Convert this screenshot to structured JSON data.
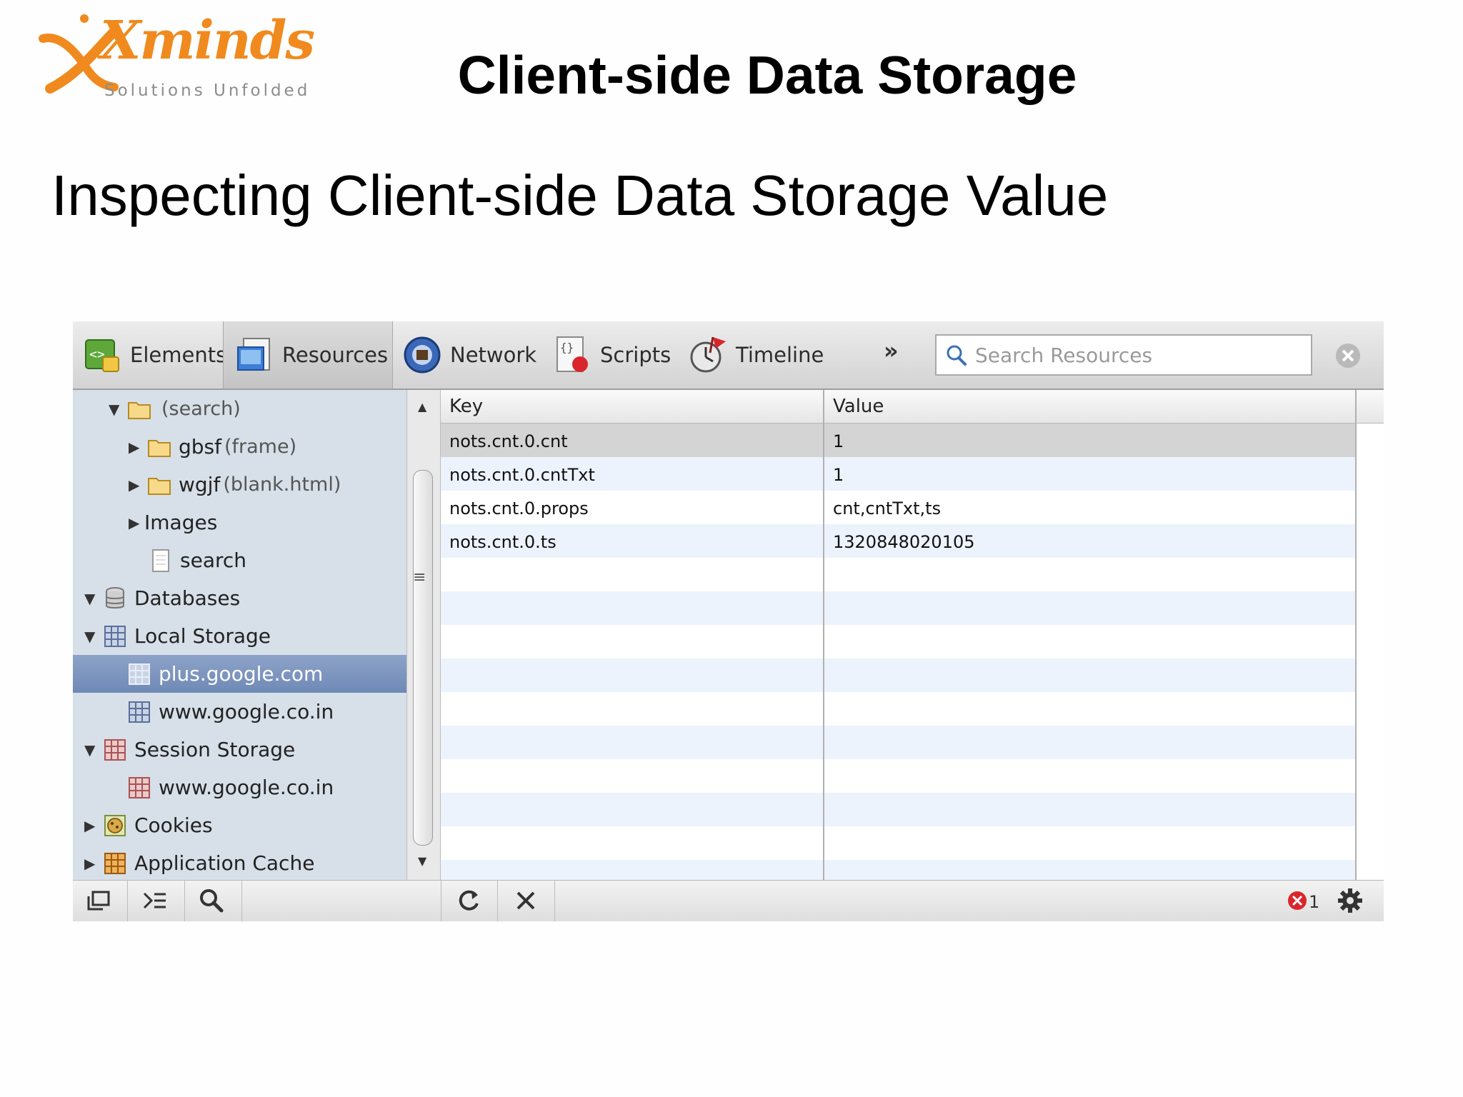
{
  "logo": {
    "word": "Xminds",
    "tagline": "Solutions Unfolded"
  },
  "slide": {
    "title": "Client-side Data Storage",
    "subtitle": "Inspecting Client-side Data Storage Value"
  },
  "toolbar": {
    "tabs": [
      {
        "label": "Elements",
        "icon": "elements-icon"
      },
      {
        "label": "Resources",
        "icon": "resources-icon",
        "selected": true
      },
      {
        "label": "Network",
        "icon": "network-icon"
      },
      {
        "label": "Scripts",
        "icon": "scripts-icon"
      },
      {
        "label": "Timeline",
        "icon": "timeline-icon"
      }
    ],
    "more": "»",
    "search_placeholder": "Search Resources"
  },
  "sidebar": {
    "items": [
      {
        "label": "(search)",
        "sub": ""
      },
      {
        "label": "gbsf",
        "sub": "(frame)"
      },
      {
        "label": "wgjf",
        "sub": "(blank.html)"
      },
      {
        "label": "Images",
        "sub": ""
      },
      {
        "label": "search",
        "sub": ""
      },
      {
        "label": "Databases",
        "sub": ""
      },
      {
        "label": "Local Storage",
        "sub": ""
      },
      {
        "label": "plus.google.com",
        "sub": ""
      },
      {
        "label": "www.google.co.in",
        "sub": ""
      },
      {
        "label": "Session Storage",
        "sub": ""
      },
      {
        "label": "www.google.co.in",
        "sub": ""
      },
      {
        "label": "Cookies",
        "sub": ""
      },
      {
        "label": "Application Cache",
        "sub": ""
      }
    ]
  },
  "table": {
    "columns": [
      "Key",
      "Value"
    ],
    "rows": [
      {
        "key": "nots.cnt.0.cnt",
        "value": "1"
      },
      {
        "key": "nots.cnt.0.cntTxt",
        "value": "1"
      },
      {
        "key": "nots.cnt.0.props",
        "value": "cnt,cntTxt,ts"
      },
      {
        "key": "nots.cnt.0.ts",
        "value": "1320848020105"
      }
    ]
  },
  "statusbar": {
    "error_count": "1"
  },
  "colors": {
    "accent_orange": "#f08a1e",
    "selection_blue": "#7b93bf",
    "sidebar_bg": "#d7dfe8",
    "row_alt": "#edf3fd"
  }
}
